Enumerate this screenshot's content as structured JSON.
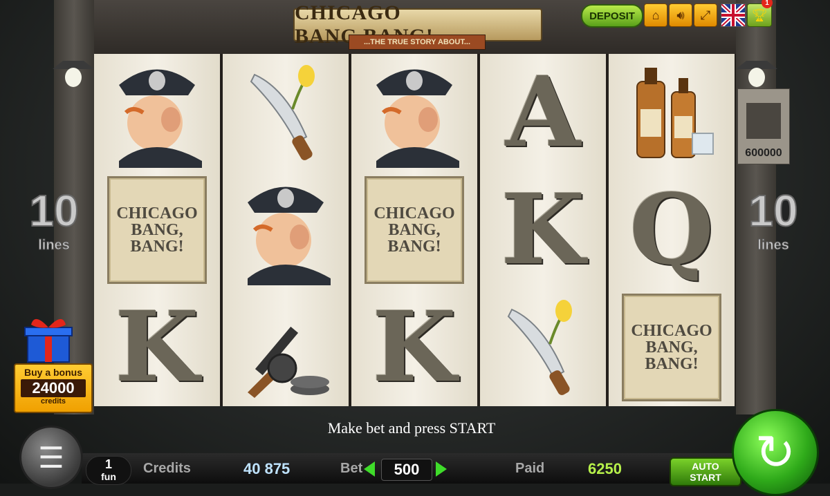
{
  "header": {
    "title": "CHICAGO BANG,BANG!",
    "subtitle": "...THE TRUE STORY ABOUT...",
    "deposit_label": "DEPOSIT",
    "notification_count": "1"
  },
  "reels": {
    "poster_line1": "CHICAGO",
    "poster_line2": "BANG,",
    "poster_line3": "BANG!",
    "letter_a": "A",
    "letter_k": "K",
    "letter_q": "Q"
  },
  "lines": {
    "value": "10",
    "label": "lines"
  },
  "bonus": {
    "title": "Buy a bonus",
    "amount": "24000",
    "unit": "credits"
  },
  "wanted": {
    "prize": "600000"
  },
  "message": "Make bet and press START",
  "footer": {
    "lines_value": "1",
    "lines_unit": "fun",
    "credits_label": "Credits",
    "credits_value": "40 875",
    "bet_label": "Bet",
    "bet_value": "500",
    "paid_label": "Paid",
    "paid_value": "6250",
    "auto_line1": "AUTO",
    "auto_line2": "START"
  },
  "colors": {
    "accent_green": "#5aa11a",
    "credits_color": "#bfe3ff",
    "paid_color": "#b6f04a"
  }
}
